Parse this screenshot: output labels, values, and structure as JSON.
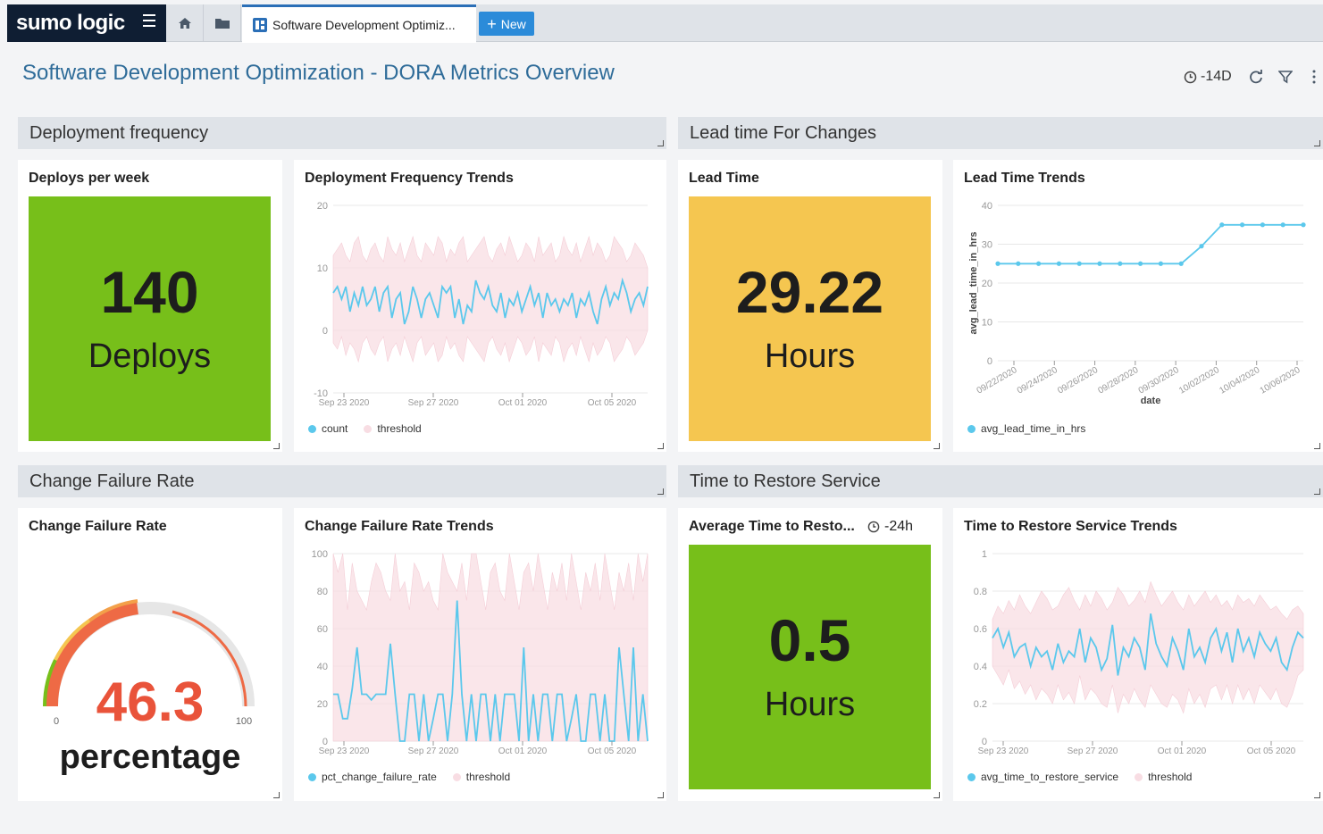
{
  "app": {
    "logo": "sumo logic"
  },
  "tabs": [
    {
      "label": "Software Development Optimiz..."
    }
  ],
  "new_button": {
    "label": "New"
  },
  "dashboard": {
    "title": "Software Development Optimization - DORA Metrics Overview",
    "time_range": "-14D"
  },
  "sections": {
    "deployment": "Deployment frequency",
    "lead_time": "Lead time For Changes",
    "failure": "Change Failure Rate",
    "restore": "Time to Restore Service"
  },
  "panels": {
    "deploys": {
      "title": "Deploys per week",
      "value": "140",
      "unit": "Deploys",
      "color": "#77bf1a"
    },
    "lead": {
      "title": "Lead Time",
      "value": "29.22",
      "unit": "Hours",
      "color": "#f5c650"
    },
    "cfr": {
      "title": "Change Failure Rate",
      "value": "46.3",
      "unit": "percentage",
      "min_label": "0",
      "max_label": "100",
      "value_color": "#e9533a"
    },
    "mttr": {
      "title": "Average Time to Resto...",
      "time_range": "-24h",
      "value": "0.5",
      "unit": "Hours",
      "color": "#77bf1a"
    }
  },
  "chart_data": [
    {
      "id": "deploy-trends",
      "type": "line",
      "title": "Deployment Frequency Trends",
      "y_ticks": [
        "20",
        "10",
        "0",
        "-10"
      ],
      "x_ticks": [
        "Sep 23 2020",
        "Sep 27 2020",
        "Oct 01 2020",
        "Oct 05 2020"
      ],
      "ylim": [
        -10,
        20
      ],
      "series": [
        {
          "name": "count",
          "color": "#5bc8ec",
          "values": [
            6,
            7,
            5,
            7,
            3,
            6,
            4,
            7,
            4,
            5,
            7,
            3,
            6,
            7,
            2,
            5,
            6,
            1,
            3,
            7,
            5,
            2,
            5,
            6,
            4,
            2,
            7,
            6,
            7,
            2,
            5,
            1,
            4,
            3,
            8,
            6,
            5,
            7,
            4,
            3,
            6,
            2,
            5,
            4,
            6,
            3,
            5,
            7,
            4,
            6,
            2,
            6,
            4,
            5,
            3,
            5,
            4,
            6,
            2,
            5,
            4,
            6,
            3,
            1,
            5,
            7,
            4,
            6,
            5,
            8,
            6,
            3,
            5,
            6,
            4,
            7
          ]
        },
        {
          "name": "threshold",
          "color": "#f8dde3",
          "upper": [
            12,
            13,
            14,
            12,
            11,
            14,
            15,
            12,
            11,
            13,
            14,
            12,
            11,
            15,
            13,
            12,
            14,
            11,
            13,
            15,
            12,
            11,
            14,
            13,
            12,
            15,
            14,
            11,
            13,
            12,
            14,
            15,
            11,
            12,
            13,
            14,
            15,
            12,
            11,
            13,
            14,
            12,
            15,
            13,
            11,
            12,
            14,
            13,
            11,
            15,
            12,
            13,
            14,
            11,
            12,
            15,
            13,
            12,
            14,
            11,
            13,
            15,
            12,
            14,
            13,
            11,
            12,
            15,
            14,
            13,
            11,
            12,
            14,
            13,
            12,
            10
          ],
          "lower": [
            -2,
            -3,
            -1,
            -4,
            -2,
            -3,
            -5,
            -2,
            -1,
            -3,
            -4,
            -2,
            -1,
            -5,
            -3,
            -2,
            -4,
            -1,
            -3,
            -5,
            -2,
            -1,
            -4,
            -3,
            -2,
            -5,
            -4,
            -1,
            -3,
            -2,
            -4,
            -5,
            -1,
            -2,
            -3,
            -4,
            -5,
            -2,
            -1,
            -3,
            -4,
            -2,
            -5,
            -3,
            -1,
            -2,
            -4,
            -3,
            -1,
            -5,
            -2,
            -3,
            -4,
            -1,
            -2,
            -5,
            -3,
            -2,
            -4,
            -1,
            -3,
            -5,
            -2,
            -4,
            -3,
            -1,
            -2,
            -5,
            -4,
            -3,
            -1,
            -2,
            -4,
            -3,
            -2,
            0
          ]
        }
      ]
    },
    {
      "id": "lead-trends",
      "type": "line",
      "title": "Lead Time Trends",
      "ylabel": "avg_lead_time_in_hrs",
      "xlabel": "date",
      "y_ticks": [
        "40",
        "30",
        "20",
        "10",
        "0"
      ],
      "ylim": [
        0,
        40
      ],
      "x_ticks": [
        "09/22/2020",
        "09/24/2020",
        "09/26/2020",
        "09/28/2020",
        "09/30/2020",
        "10/02/2020",
        "10/04/2020",
        "10/06/2020"
      ],
      "series": [
        {
          "name": "avg_lead_time_in_hrs",
          "color": "#5bc8ec",
          "values": [
            25,
            25,
            25,
            25,
            25,
            25,
            25,
            25,
            25,
            25,
            29.5,
            35,
            35,
            35,
            35,
            35
          ]
        }
      ]
    },
    {
      "id": "cfr-trends",
      "type": "line",
      "title": "Change Failure Rate Trends",
      "y_ticks": [
        "100",
        "80",
        "60",
        "40",
        "20",
        "0"
      ],
      "x_ticks": [
        "Sep 23 2020",
        "Sep 27 2020",
        "Oct 01 2020",
        "Oct 05 2020"
      ],
      "ylim": [
        0,
        100
      ],
      "series": [
        {
          "name": "pct_change_failure_rate",
          "color": "#5bc8ec",
          "values": [
            25,
            25,
            12,
            12,
            28,
            50,
            25,
            25,
            22,
            25,
            25,
            25,
            52,
            25,
            0,
            0,
            25,
            25,
            0,
            25,
            0,
            12,
            25,
            25,
            0,
            25,
            75,
            25,
            0,
            25,
            0,
            25,
            25,
            0,
            25,
            0,
            25,
            25,
            25,
            0,
            50,
            0,
            25,
            0,
            25,
            25,
            0,
            25,
            25,
            0,
            12,
            25,
            0,
            0,
            25,
            25,
            0,
            25,
            0,
            0,
            50,
            25,
            0,
            50,
            0,
            25,
            0
          ]
        },
        {
          "name": "threshold",
          "color": "#f8dde3",
          "upper": [
            100,
            90,
            100,
            70,
            95,
            80,
            75,
            70,
            85,
            95,
            90,
            80,
            75,
            100,
            80,
            85,
            70,
            95,
            90,
            80,
            85,
            75,
            70,
            100,
            90,
            85,
            80,
            95,
            75,
            100,
            100,
            85,
            70,
            90,
            95,
            80,
            75,
            100,
            85,
            70,
            90,
            95,
            80,
            100,
            85,
            70,
            90,
            80,
            95,
            75,
            100,
            85,
            70,
            90,
            80,
            95,
            75,
            100,
            85,
            70,
            90,
            80,
            95,
            75,
            100,
            85,
            100
          ],
          "lower": [
            0,
            0,
            0,
            0,
            0,
            0,
            0,
            0,
            0,
            0,
            0,
            0,
            0,
            0,
            0,
            0,
            0,
            0,
            0,
            0,
            0,
            0,
            0,
            0,
            0,
            0,
            0,
            0,
            0,
            0,
            0,
            0,
            0,
            0,
            0,
            0,
            0,
            0,
            0,
            0,
            0,
            0,
            0,
            0,
            0,
            0,
            0,
            0,
            0,
            0,
            0,
            0,
            0,
            0,
            0,
            0,
            0,
            0,
            0,
            0,
            0,
            0,
            0,
            0,
            0,
            0,
            0
          ]
        }
      ]
    },
    {
      "id": "restore-trends",
      "type": "line",
      "title": "Time to Restore Service Trends",
      "y_ticks": [
        "1",
        "0.8",
        "0.6",
        "0.4",
        "0.2",
        "0"
      ],
      "x_ticks": [
        "Sep 23 2020",
        "Sep 27 2020",
        "Oct 01 2020",
        "Oct 05 2020"
      ],
      "ylim": [
        0,
        1
      ],
      "series": [
        {
          "name": "avg_time_to_restore_service",
          "color": "#5bc8ec",
          "values": [
            0.55,
            0.6,
            0.5,
            0.58,
            0.45,
            0.5,
            0.52,
            0.4,
            0.5,
            0.45,
            0.48,
            0.38,
            0.52,
            0.42,
            0.48,
            0.45,
            0.6,
            0.42,
            0.55,
            0.5,
            0.38,
            0.44,
            0.62,
            0.35,
            0.5,
            0.45,
            0.55,
            0.5,
            0.38,
            0.68,
            0.52,
            0.45,
            0.4,
            0.55,
            0.48,
            0.38,
            0.6,
            0.45,
            0.5,
            0.42,
            0.55,
            0.6,
            0.48,
            0.58,
            0.42,
            0.6,
            0.48,
            0.55,
            0.45,
            0.58,
            0.52,
            0.48,
            0.55,
            0.42,
            0.38,
            0.5,
            0.58,
            0.55
          ]
        },
        {
          "name": "threshold",
          "color": "#f8dde3",
          "upper": [
            0.65,
            0.72,
            0.68,
            0.75,
            0.7,
            0.78,
            0.72,
            0.68,
            0.74,
            0.8,
            0.76,
            0.7,
            0.72,
            0.78,
            0.82,
            0.75,
            0.7,
            0.78,
            0.72,
            0.8,
            0.76,
            0.7,
            0.74,
            0.82,
            0.78,
            0.72,
            0.75,
            0.8,
            0.74,
            0.85,
            0.78,
            0.72,
            0.76,
            0.8,
            0.74,
            0.7,
            0.78,
            0.72,
            0.76,
            0.8,
            0.74,
            0.78,
            0.72,
            0.75,
            0.7,
            0.78,
            0.74,
            0.76,
            0.72,
            0.78,
            0.74,
            0.7,
            0.72,
            0.68,
            0.65,
            0.7,
            0.72,
            0.68
          ],
          "lower": [
            0.4,
            0.35,
            0.3,
            0.38,
            0.28,
            0.32,
            0.25,
            0.3,
            0.22,
            0.28,
            0.25,
            0.2,
            0.3,
            0.22,
            0.26,
            0.2,
            0.35,
            0.22,
            0.28,
            0.25,
            0.2,
            0.18,
            0.3,
            0.15,
            0.25,
            0.2,
            0.28,
            0.22,
            0.18,
            0.3,
            0.25,
            0.2,
            0.18,
            0.25,
            0.22,
            0.15,
            0.28,
            0.2,
            0.25,
            0.18,
            0.28,
            0.3,
            0.22,
            0.3,
            0.2,
            0.3,
            0.22,
            0.28,
            0.2,
            0.3,
            0.26,
            0.22,
            0.28,
            0.2,
            0.18,
            0.25,
            0.35,
            0.38
          ]
        }
      ]
    }
  ]
}
